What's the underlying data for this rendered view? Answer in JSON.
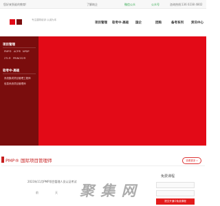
{
  "topbar": {
    "welcome": "您好来到谁的教育!",
    "about": "了解筑企",
    "wechat": "微信公众",
    "weibo": "公众号",
    "phone_label": "咨询热线:",
    "phone": "136 0238 4802"
  },
  "header": {
    "logo_text": "专注建筑培训 以诚为本"
  },
  "nav": [
    {
      "label": "项目管理"
    },
    {
      "label": "软考中·高级"
    },
    {
      "label": "国企"
    },
    {
      "label": "团购"
    },
    {
      "label": "备考系列"
    },
    {
      "label": "资讯中心"
    }
  ],
  "sidebar": {
    "section1": {
      "title": "项目管理",
      "items": [
        {
          "label": "PMP®"
        },
        {
          "label": "ACP®"
        },
        {
          "label": "NPDP"
        },
        {
          "label": "PRINCE2®"
        },
        {
          "label": "2TL®"
        }
      ]
    },
    "section2": {
      "title": "软考中·高级",
      "items": [
        {
          "label": "系统集成项目管理工程师"
        },
        {
          "label": "信息系统项目管理师"
        }
      ]
    }
  },
  "certification": {
    "title": "PMP® 国际项目管理师",
    "more": "查看更多 »"
  },
  "announcement": {
    "text": "2023年11月PMP项目管理人员认证考试",
    "months": [
      "前",
      "天"
    ]
  },
  "watermark": "聚 集 网",
  "free_course": {
    "title": "免费课程",
    "submit": "提交开通中免费课程"
  },
  "colors": {
    "brand_red": "#e30a17",
    "sidebar_dark_red": "#7a0d0d",
    "accent_green": "#2ea84a"
  }
}
